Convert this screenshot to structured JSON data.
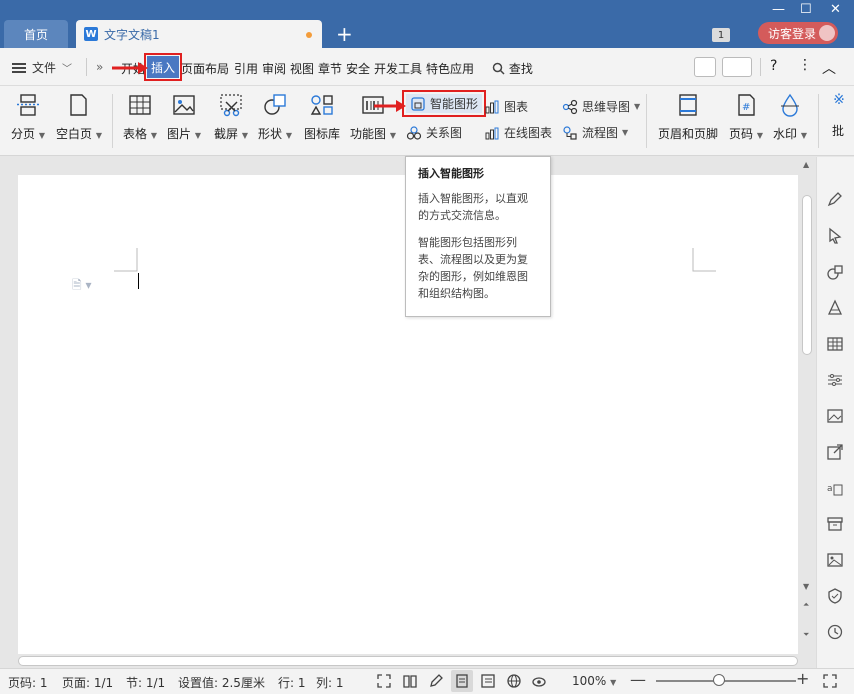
{
  "titlebar": {
    "home_tab": "首页",
    "doc_tab": "文字文稿1",
    "doc_icon_letter": "W",
    "badge": "1",
    "login": "访客登录"
  },
  "menubar": {
    "file": "文件",
    "items": [
      "开始",
      "插入",
      "页面布局",
      "引用",
      "审阅",
      "视图",
      "章节",
      "安全",
      "开发工具",
      "特色应用"
    ],
    "search": "查找"
  },
  "ribbon": {
    "page_break": "分页",
    "blank_page": "空白页",
    "table": "表格",
    "image": "图片",
    "screenshot": "截屏",
    "shape": "形状",
    "icon_lib": "图标库",
    "function_chart": "功能图",
    "smart_art": "智能图形",
    "relation": "关系图",
    "chart": "图表",
    "online_chart": "在线图表",
    "mind_map": "思维导图",
    "flowchart": "流程图",
    "header_footer": "页眉和页脚",
    "page_number": "页码",
    "watermark": "水印",
    "cut_label": "批"
  },
  "tooltip": {
    "title": "插入智能图形",
    "p1": "插入智能图形，以直观的方式交流信息。",
    "p2": "智能图形包括图形列表、流程图以及更为复杂的图形，例如维恩图和组织结构图。"
  },
  "statusbar": {
    "page": "页码: 1",
    "pages": "页面: 1/1",
    "section": "节: 1/1",
    "setting": "设置值: 2.5厘米",
    "row": "行: 1",
    "col": "列: 1",
    "zoom": "100%",
    "zoom_fraction": 0.45
  },
  "colors": {
    "title_bar": "#3a6aa8",
    "active_tab": "#4a78c2",
    "highlight": "#e02020",
    "login": "#d45b5b"
  }
}
